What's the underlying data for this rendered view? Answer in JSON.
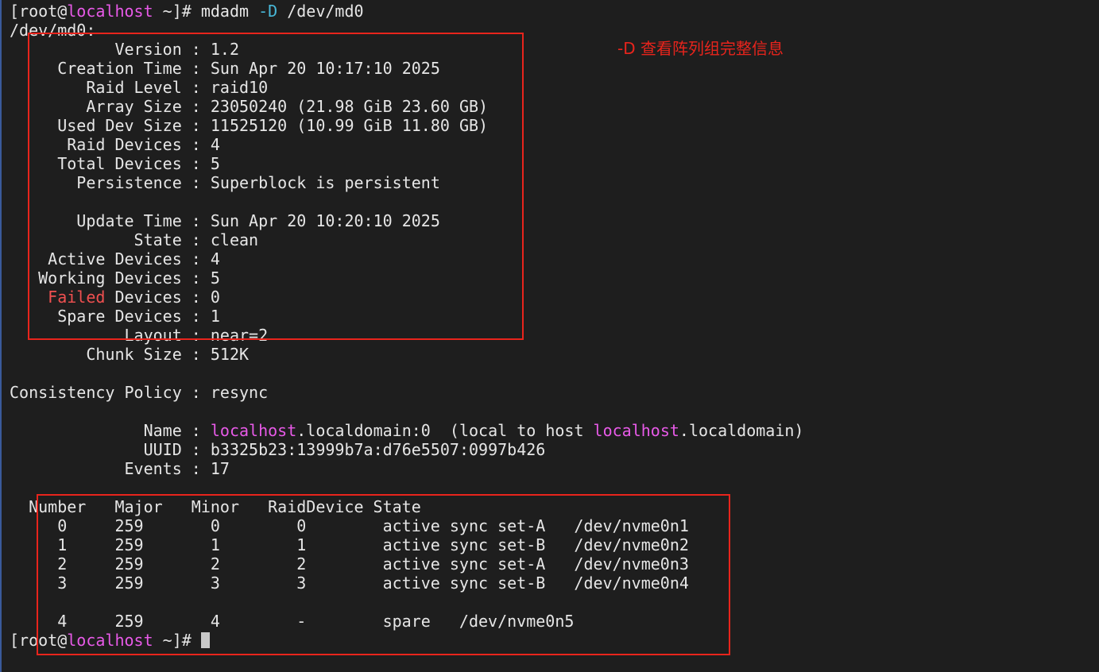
{
  "prompt": {
    "open": "[root@",
    "host": "localhost",
    "close": " ~]# "
  },
  "command": {
    "name": "mdadm ",
    "flag": "-D",
    "arg": " /dev/md0"
  },
  "device_header": "/dev/md0:",
  "details": [
    {
      "label": "Version",
      "value": "1.2"
    },
    {
      "label": "Creation Time",
      "value": "Sun Apr 20 10:17:10 2025"
    },
    {
      "label": "Raid Level",
      "value": "raid10"
    },
    {
      "label": "Array Size",
      "value": "23050240 (21.98 GiB 23.60 GB)"
    },
    {
      "label": "Used Dev Size",
      "value": "11525120 (10.99 GiB 11.80 GB)"
    },
    {
      "label": "Raid Devices",
      "value": "4"
    },
    {
      "label": "Total Devices",
      "value": "5"
    },
    {
      "label": "Persistence",
      "value": "Superblock is persistent"
    },
    {
      "label": "",
      "value": ""
    },
    {
      "label": "Update Time",
      "value": "Sun Apr 20 10:20:10 2025"
    },
    {
      "label": "State",
      "value": "clean"
    },
    {
      "label": "Active Devices",
      "value": "4"
    },
    {
      "label": "Working Devices",
      "value": "5"
    },
    {
      "label": "Failed",
      "label_rest": " Devices",
      "value": "0"
    },
    {
      "label": "Spare Devices",
      "value": "1"
    },
    {
      "label": "Layout",
      "value": "near=2"
    },
    {
      "label": "Chunk Size",
      "value": "512K"
    },
    {
      "label": "",
      "value": ""
    },
    {
      "label": "Consistency Policy",
      "value": "resync"
    },
    {
      "label": "",
      "value": ""
    }
  ],
  "name_line": {
    "label": "Name",
    "host1": "localhost",
    "mid": ".localdomain:0  (local to host ",
    "host2": "localhost",
    "end": ".localdomain)"
  },
  "uuid_line": {
    "label": "UUID",
    "value": "b3325b23:13999b7a:d76e5507:0997b426"
  },
  "events_line": {
    "label": "Events",
    "value": "17"
  },
  "table": {
    "headers": [
      "Number",
      "Major",
      "Minor",
      "RaidDevice",
      "State"
    ],
    "rows": [
      {
        "number": "0",
        "major": "259",
        "minor": "0",
        "raid": "0",
        "state": "active sync set-A",
        "device": "/dev/nvme0n1"
      },
      {
        "number": "1",
        "major": "259",
        "minor": "1",
        "raid": "1",
        "state": "active sync set-B",
        "device": "/dev/nvme0n2"
      },
      {
        "number": "2",
        "major": "259",
        "minor": "2",
        "raid": "2",
        "state": "active sync set-A",
        "device": "/dev/nvme0n3"
      },
      {
        "number": "3",
        "major": "259",
        "minor": "3",
        "raid": "3",
        "state": "active sync set-B",
        "device": "/dev/nvme0n4"
      }
    ],
    "spare_row": {
      "number": "4",
      "major": "259",
      "minor": "4",
      "raid": "-",
      "state": "spare",
      "device": "/dev/nvme0n5"
    }
  },
  "annotation": "-D 查看阵列组完整信息",
  "colors": {
    "background": "#1e1e1e",
    "text": "#e6e6e6",
    "host": "#e85ae8",
    "flag": "#48b8d8",
    "failed": "#f05050",
    "annotation": "#e8241c"
  }
}
